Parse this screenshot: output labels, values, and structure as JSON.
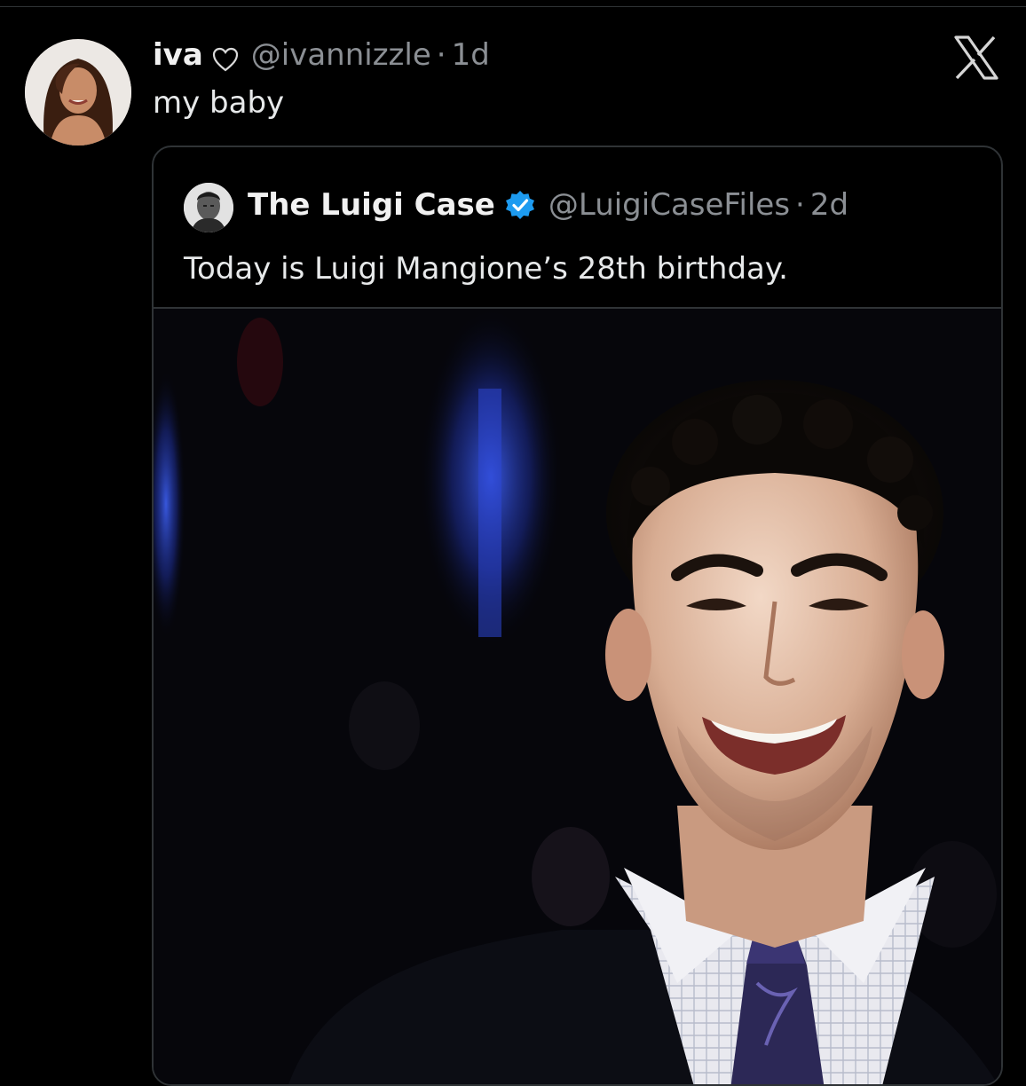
{
  "post": {
    "display_name": "iva",
    "handle": "@ivannizzle",
    "separator": "·",
    "time": "1d",
    "text": "my baby"
  },
  "quote": {
    "display_name": "The Luigi Case",
    "handle": "@LuigiCaseFiles",
    "separator": "·",
    "time": "2d",
    "text": "Today is Luigi Mangione’s 28th birthday."
  },
  "icons": {
    "heart": "heart-outline-icon",
    "verified": "verified-badge-icon",
    "logo": "x-logo-icon"
  },
  "colors": {
    "background": "#000000",
    "text_primary": "#e7e9ea",
    "text_secondary": "#8b8f94",
    "border": "#2f3336",
    "verified_blue": "#1d9bf0"
  }
}
